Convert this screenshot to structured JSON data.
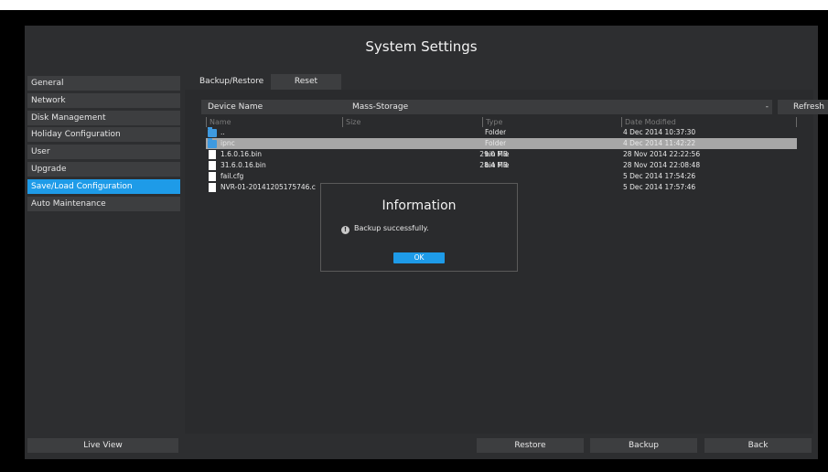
{
  "window": {
    "title": "System Settings"
  },
  "sidebar": {
    "items": [
      {
        "label": "General",
        "active": false
      },
      {
        "label": "Network",
        "active": false
      },
      {
        "label": "Disk Management",
        "active": false
      },
      {
        "label": "Holiday Configuration",
        "active": false
      },
      {
        "label": "User",
        "active": false
      },
      {
        "label": "Upgrade",
        "active": false
      },
      {
        "label": "Save/Load Configuration",
        "active": true
      },
      {
        "label": "Auto Maintenance",
        "active": false
      }
    ],
    "live_view_label": "Live View"
  },
  "tabs": [
    {
      "label": "Backup/Restore",
      "active": true
    },
    {
      "label": "Reset",
      "active": false
    }
  ],
  "device": {
    "label": "Device Name",
    "value": "Mass-Storage",
    "arrow": "-",
    "refresh_label": "Refresh"
  },
  "file_table": {
    "headers": {
      "name": "Name",
      "size": "Size",
      "type": "Type",
      "date": "Date Modified"
    },
    "rows": [
      {
        "icon": "folder-icon",
        "name": "..",
        "size": "",
        "type": "Folder",
        "date": "4 Dec 2014 10:37:30",
        "selected": false
      },
      {
        "icon": "folder-icon",
        "name": "ipnc",
        "size": "",
        "type": "Folder",
        "date": "4 Dec 2014 11:42:22",
        "selected": true
      },
      {
        "icon": "file-icon",
        "name": "1.6.0.16.bin",
        "size": "29.0 MB",
        "type": "bin File",
        "date": "28 Nov 2014 22:22:56",
        "selected": false
      },
      {
        "icon": "file-icon",
        "name": "31.6.0.16.bin",
        "size": "28.4 MB",
        "type": "bin File",
        "date": "28 Nov 2014 22:08:48",
        "selected": false
      },
      {
        "icon": "file-icon",
        "name": "fail.cfg",
        "size": "",
        "type": "",
        "date": "5 Dec 2014 17:54:26",
        "selected": false
      },
      {
        "icon": "file-icon",
        "name": "NVR-01-20141205175746.c",
        "size": "",
        "type": "",
        "date": "5 Dec 2014 17:57:46",
        "selected": false
      }
    ]
  },
  "dialog": {
    "title": "Information",
    "message": "Backup successfully.",
    "info_icon_glyph": "!",
    "ok_label": "OK"
  },
  "actions": {
    "restore_label": "Restore",
    "backup_label": "Backup",
    "back_label": "Back"
  },
  "colors": {
    "accent": "#1e9be8",
    "window_bg": "#2d2e30",
    "button_bg": "#3d3e40",
    "selected_row": "#a7a7a7"
  }
}
